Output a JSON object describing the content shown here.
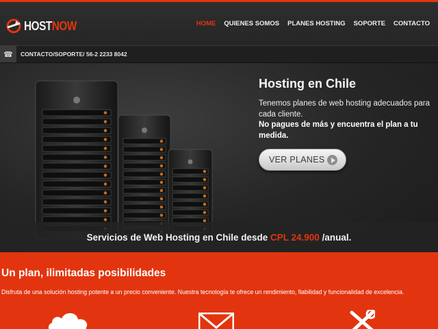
{
  "header": {
    "logo": {
      "host": "HOST",
      "now": "NOW"
    },
    "nav": [
      {
        "label": "HOME",
        "active": true
      },
      {
        "label": "QUIENES SOMOS",
        "active": false
      },
      {
        "label": "PLANES HOSTING",
        "active": false
      },
      {
        "label": "SOPORTE",
        "active": false
      },
      {
        "label": "CONTACTO",
        "active": false
      }
    ]
  },
  "contact_bar": {
    "icon": "phone-icon",
    "text": "CONTACTO/SOPORTE/ 56-2 2233 8042"
  },
  "hero": {
    "title": "Hosting en Chile",
    "text": "Tenemos planes de web hosting adecuados para cada cliente.",
    "strong": "No pagues de más y encuentra el plan a tu medida.",
    "button_label": "VER PLANES",
    "promo_prefix": "Servicios de Web Hosting en Chile desde",
    "promo_price": "CPL 24.900",
    "promo_suffix": "/anual."
  },
  "feature": {
    "title": "Un plan, ilimitadas posibilidades",
    "text": "Disfruta de una solución hosting potente a un precio conveniente. Nuestra tecnología te ofrece un rendimiento, fiabilidad y funcionalidad de excelencia.",
    "icons": [
      "cloud-icon",
      "envelope-icon",
      "tools-icon"
    ]
  },
  "colors": {
    "accent": "#e2350f",
    "dark": "#2a2a2a",
    "header": "#2e2e2e"
  }
}
